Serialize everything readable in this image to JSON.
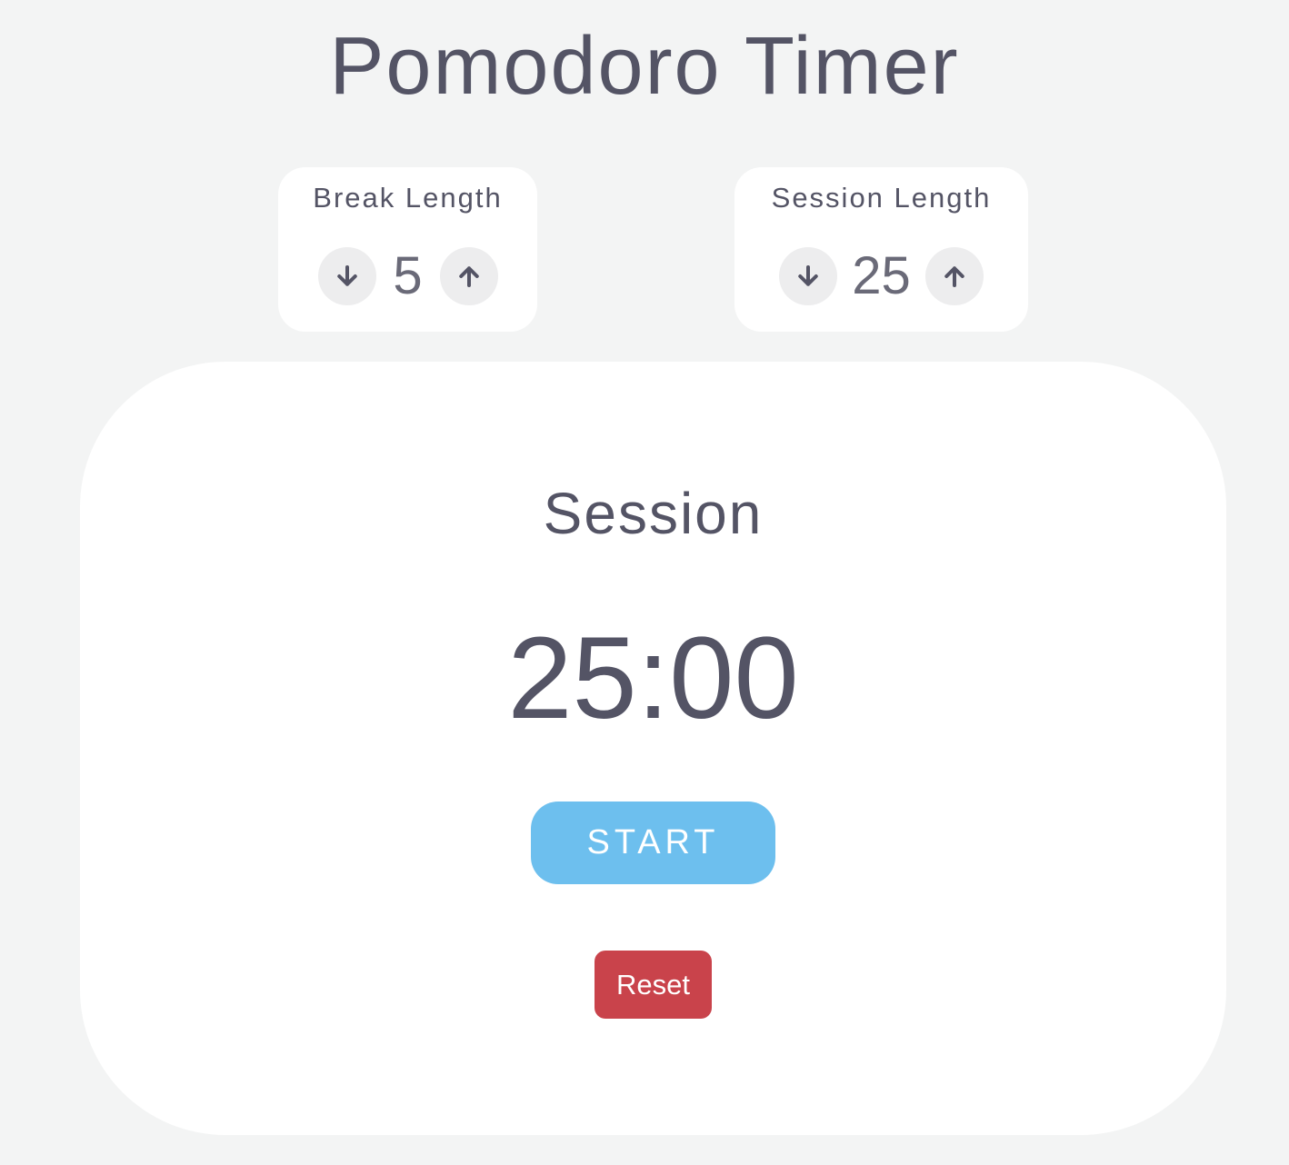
{
  "title": "Pomodoro Timer",
  "break": {
    "label": "Break Length",
    "value": "5",
    "decrement_icon": "arrow-down-icon",
    "increment_icon": "arrow-up-icon"
  },
  "session": {
    "label": "Session Length",
    "value": "25",
    "decrement_icon": "arrow-down-icon",
    "increment_icon": "arrow-up-icon"
  },
  "timer": {
    "mode": "Session",
    "time": "25:00"
  },
  "buttons": {
    "start": "START",
    "reset": "Reset"
  },
  "colors": {
    "background": "#f3f4f4",
    "text": "#545465",
    "start": "#6dbfee",
    "reset": "#c9434b"
  }
}
